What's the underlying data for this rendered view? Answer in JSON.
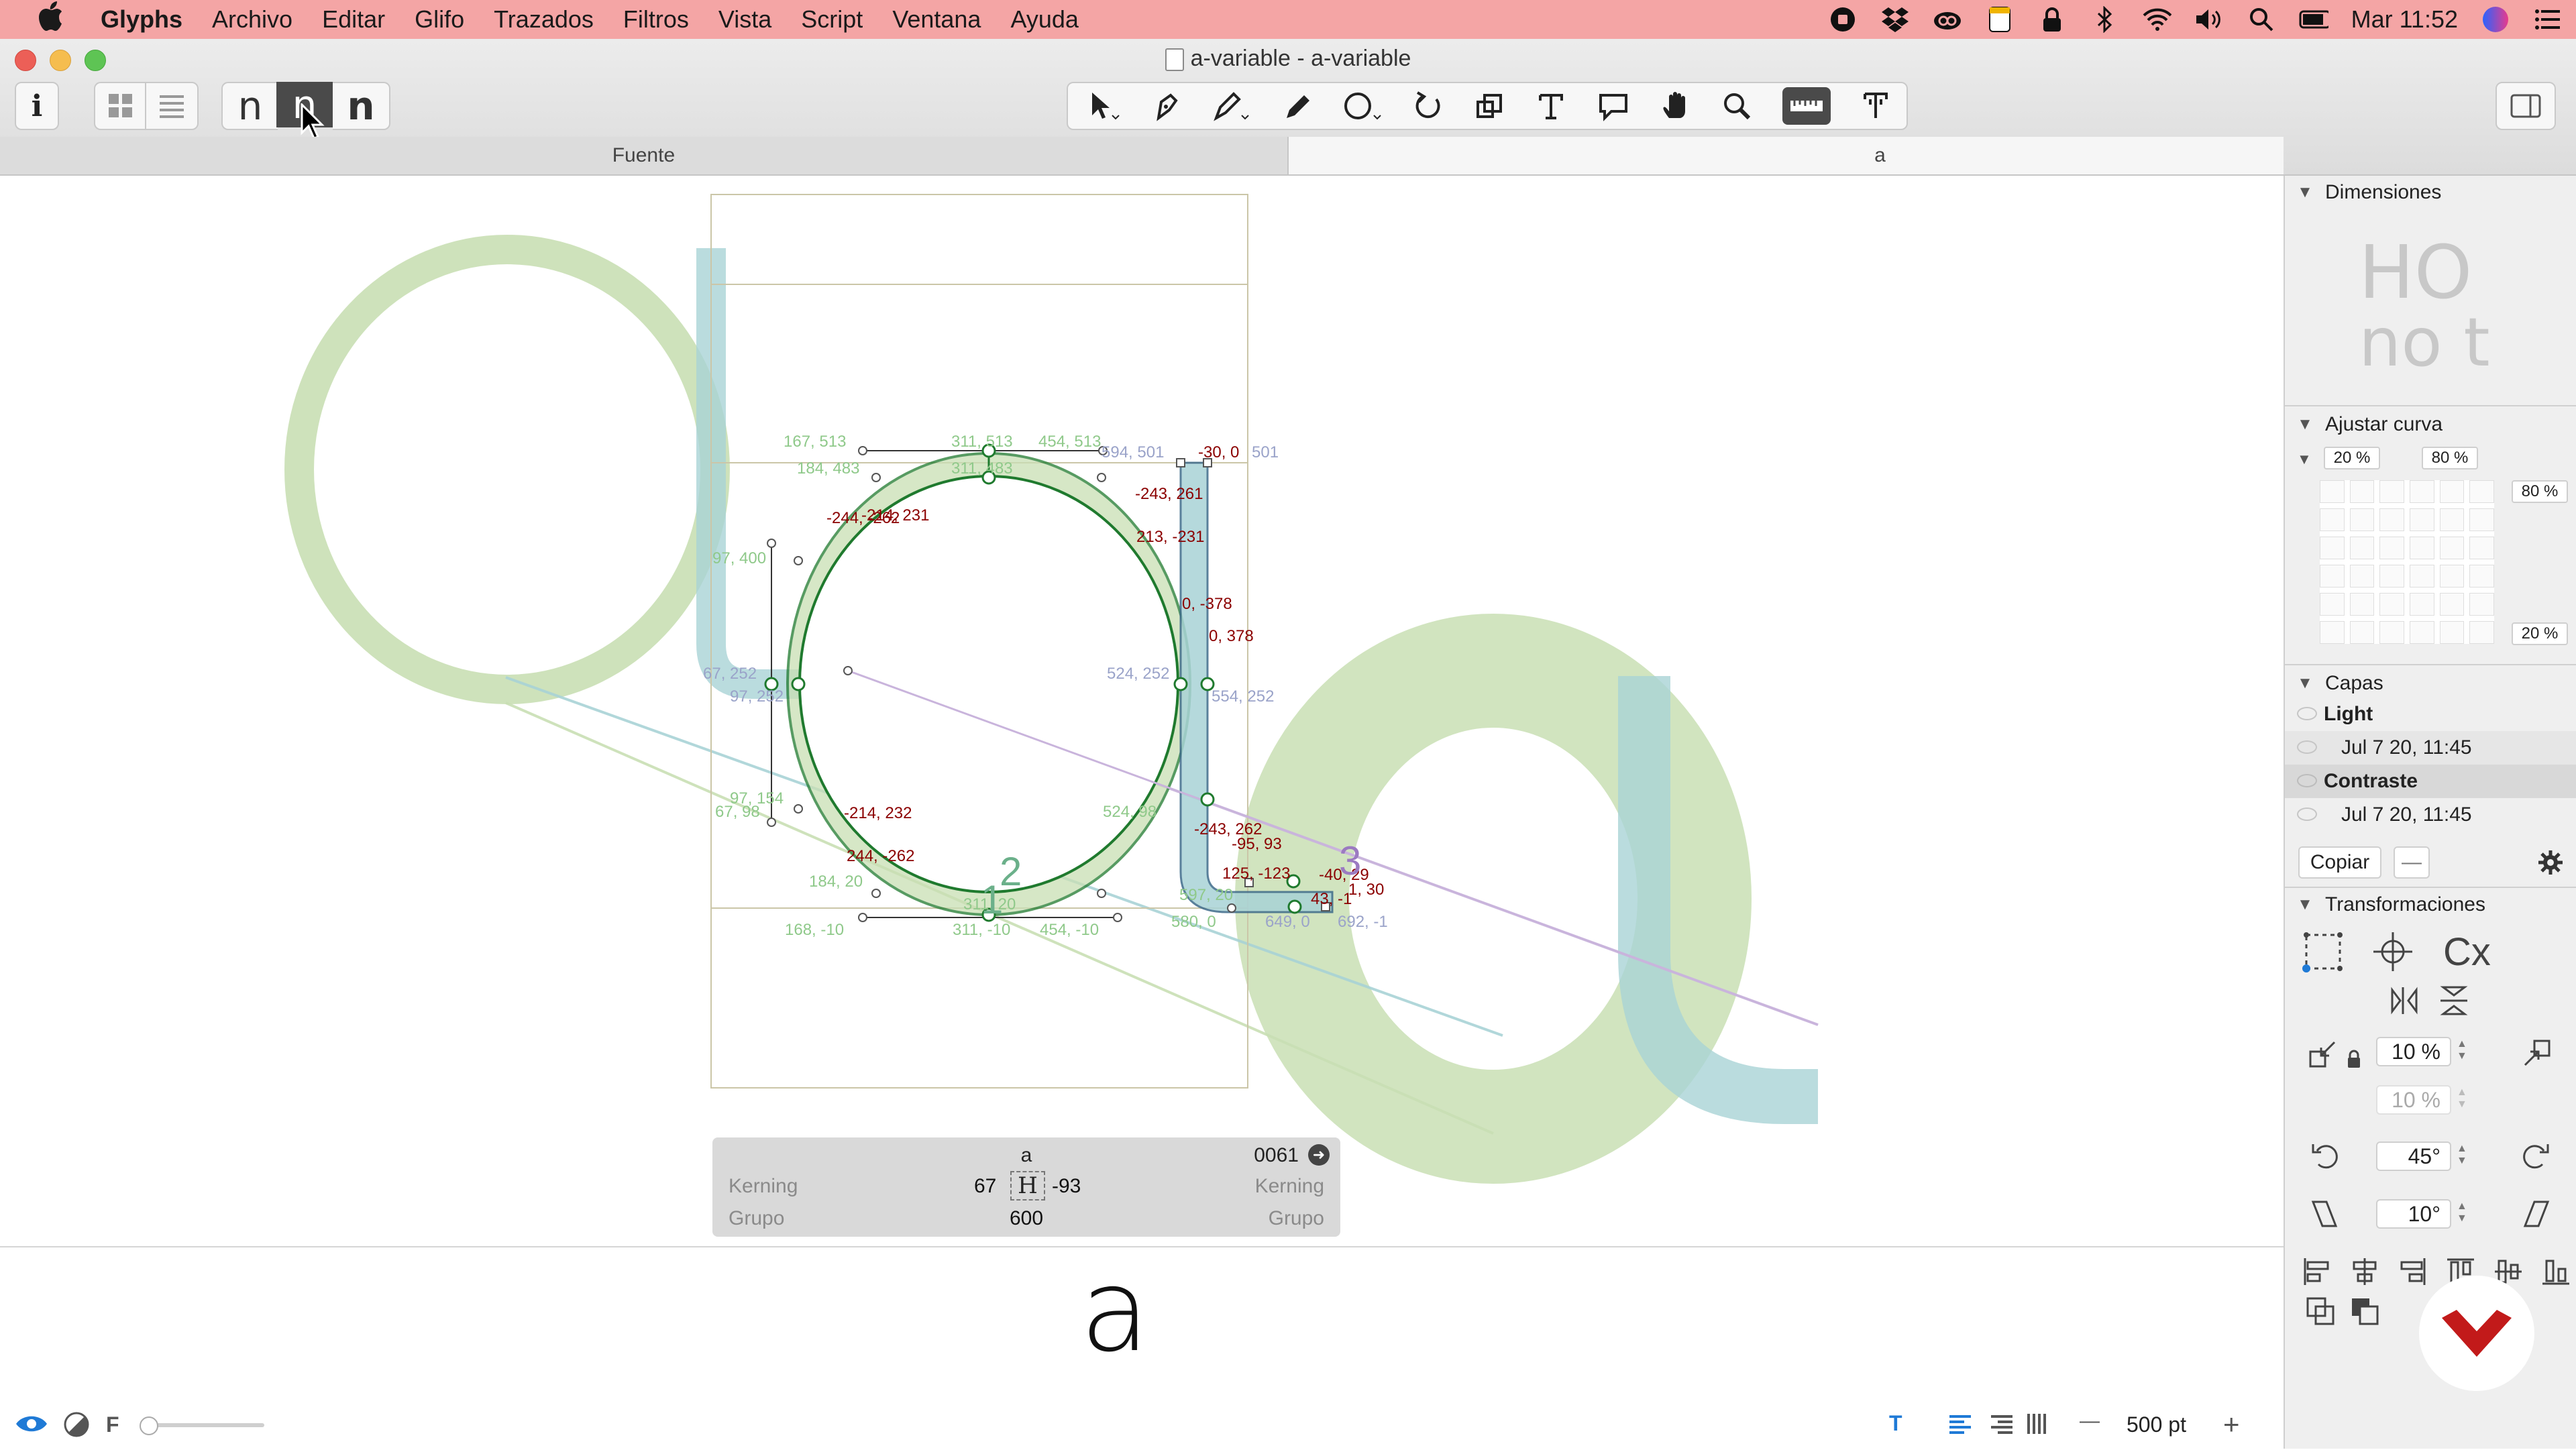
{
  "menubar": {
    "app_name": "Glyphs",
    "items": [
      "Archivo",
      "Editar",
      "Glifo",
      "Trazados",
      "Filtros",
      "Vista",
      "Script",
      "Ventana",
      "Ayuda"
    ],
    "clock": "Mar 11:52",
    "status_icons": [
      "record-icon",
      "dropbox-icon",
      "creative-cloud-icon",
      "notes-icon",
      "lock-icon",
      "bluetooth-icon",
      "wifi-icon",
      "volume-icon",
      "spotlight-search-icon",
      "battery-icon",
      "siri-icon",
      "control-center-icon"
    ]
  },
  "window": {
    "title": "a-variable - a-variable",
    "toolbar_glyph_buttons": [
      "n",
      "n",
      "n"
    ],
    "tools": [
      "select-tool-icon",
      "select-all-layers-icon",
      "draw-tool-icon",
      "pencil-tool-icon",
      "primitives-tool-icon",
      "rotate-tool-icon",
      "scale-tool-icon",
      "text-tool-icon",
      "annotation-tool-icon",
      "hand-tool-icon",
      "zoom-tool-icon",
      "measurement-tool-icon",
      "anchor-tool-icon"
    ],
    "colors": {
      "menubar": "#f4a5a5",
      "outline_green": "#1f7a2e",
      "fill_green": "#c9dfb4",
      "fill_teal": "#a9d3d6",
      "measure_red": "#8b0000"
    }
  },
  "tabs": {
    "font_tab": "Fuente",
    "glyph_tab": "a"
  },
  "canvas": {
    "labels": {
      "l1": "167, 513",
      "l2": "311, 513",
      "l3": "454, 513",
      "l4": "594, 501",
      "l5": "-30, 0",
      "l6": "501",
      "l7": "184, 483",
      "l8": "311, 483",
      "l9": "-243, 261",
      "l10": "-244, -262",
      "l11": "-214, 231",
      "l12": "213, -231",
      "l13": "0, -378",
      "l14": "0, 378",
      "l15": "97, 400",
      "l16": "67, 252",
      "l17": "97, 252",
      "l18": "524, 252",
      "l19": "554, 252",
      "l20": "97, 154",
      "l21": "67, 98",
      "l22": "-214, 232",
      "l23": "244, -262",
      "l24": "-95, 93",
      "l25": "125, -123",
      "l26": "184, 20",
      "l27": "311, 20",
      "l28": "597, 20",
      "l29": "168, -10",
      "l30": "311, -10",
      "l31": "454, -10",
      "l32": "580, 0",
      "l33": "649, 0",
      "l34": "692, -1",
      "l35": "-243, 262",
      "l36": "-40, 29",
      "l37": "1, 30",
      "l38": "43, -1",
      "l39": "524, 98",
      "n1": "1",
      "n2": "2",
      "n3": "3"
    }
  },
  "infobox": {
    "glyph_name": "a",
    "unicode": "0061",
    "kerning_label": "Kerning",
    "group_label": "Grupo",
    "left_kerning": "67",
    "right_kerning": "-93",
    "width": "600"
  },
  "preview": {
    "text": "a"
  },
  "panel": {
    "dimensions_title": "Dimensiones",
    "dimensions_sample_top": "HO",
    "dimensions_sample_bottom": "no t",
    "curve_title": "Ajustar curva",
    "curve_min": "20 %",
    "curve_max": "80 %",
    "curve_right_top": "80 %",
    "curve_right_bottom": "20 %",
    "layers_title": "Capas",
    "layers": [
      {
        "name": "Light"
      },
      {
        "name": "Jul 7 20, 11:45"
      },
      {
        "name": "Contraste"
      },
      {
        "name": "Jul 7 20, 11:45"
      }
    ],
    "copy_button": "Copiar",
    "minus_button": "—",
    "transform_title": "Transformaciones",
    "cx_label": "Cx",
    "scale_value": "10 %",
    "scale_value_2": "10 %",
    "rotate_value": "45°",
    "slant_value": "10°"
  },
  "bottom": {
    "f_label": "F",
    "zoom_value": "500 pt",
    "zoom_minus": "—",
    "zoom_plus": "+",
    "text_tool_label": "T"
  }
}
